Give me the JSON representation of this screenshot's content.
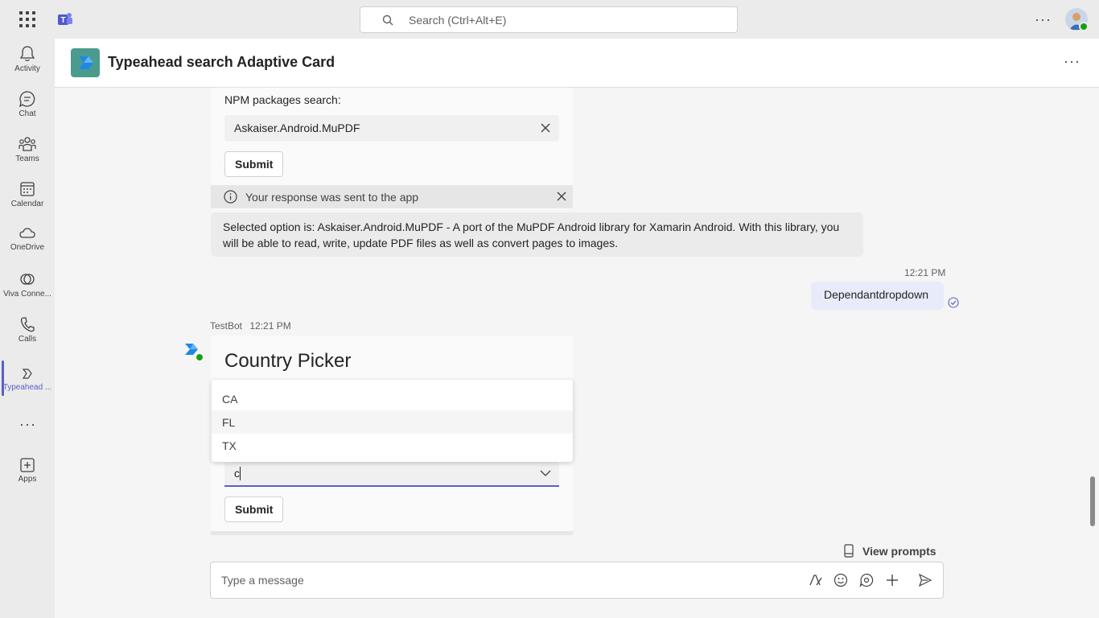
{
  "topbar": {
    "search_placeholder": "Search (Ctrl+Alt+E)",
    "more_label": "···"
  },
  "rail": {
    "items": [
      {
        "label": "Activity",
        "icon": "bell-icon"
      },
      {
        "label": "Chat",
        "icon": "chat-icon"
      },
      {
        "label": "Teams",
        "icon": "teams-icon"
      },
      {
        "label": "Calendar",
        "icon": "calendar-icon"
      },
      {
        "label": "OneDrive",
        "icon": "cloud-icon"
      },
      {
        "label": "Viva Conne...",
        "icon": "viva-icon"
      },
      {
        "label": "Calls",
        "icon": "phone-icon"
      },
      {
        "label": "Typeahead ...",
        "icon": "app-icon"
      },
      {
        "label": "Apps",
        "icon": "apps-icon"
      }
    ],
    "more_label": "···"
  },
  "header": {
    "title": "Typeahead search Adaptive Card",
    "more_label": "···"
  },
  "card1": {
    "label": "NPM packages search:",
    "input_value": "Askaiser.Android.MuPDF",
    "submit_label": "Submit",
    "response_text": "Your response was sent to the app"
  },
  "message2": {
    "text": "Selected option is: Askaiser.Android.MuPDF - A port of the MuPDF Android library for Xamarin Android. With this library, you will be able to read, write, update PDF files as well as convert pages to images."
  },
  "sent": {
    "time": "12:21 PM",
    "text": "Dependantdropdown"
  },
  "bot": {
    "name": "TestBot",
    "time": "12:21 PM"
  },
  "card2": {
    "title": "Country Picker",
    "input_value": "c",
    "submit_label": "Submit",
    "options": [
      "CA",
      "FL",
      "TX"
    ],
    "hovered_option": "FL"
  },
  "composer": {
    "view_prompts_label": "View prompts",
    "placeholder": "Type a message"
  },
  "colors": {
    "accent": "#5b5fc7",
    "presence": "#13a10e",
    "app_tile": "#4a9b8e"
  }
}
